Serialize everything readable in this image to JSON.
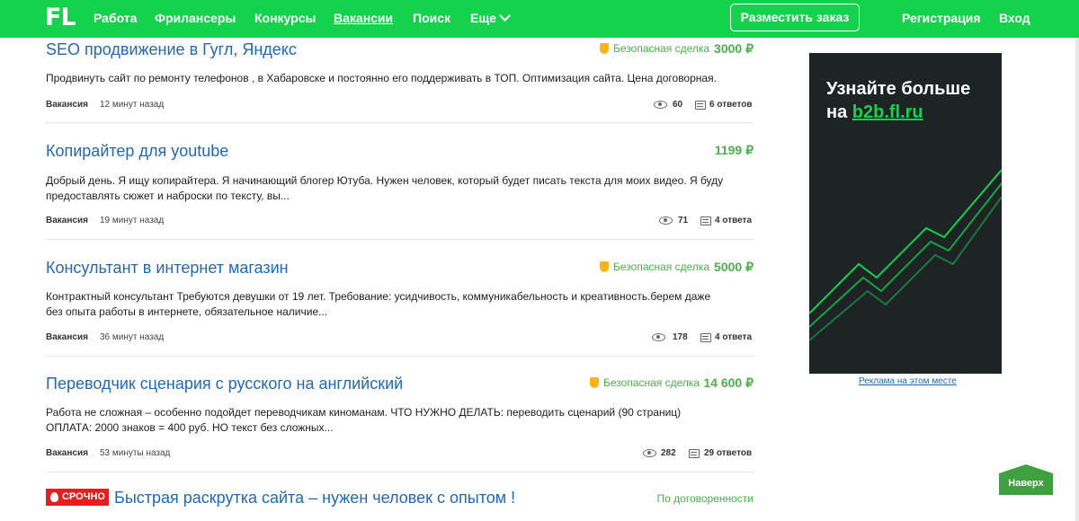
{
  "header": {
    "logo": "FL",
    "nav": [
      "Работа",
      "Фрилансеры",
      "Конкурсы",
      "Вакансии",
      "Поиск",
      "Еще"
    ],
    "post_order": "Разместить заказ",
    "register": "Регистрация",
    "login": "Вход"
  },
  "jobs": [
    {
      "title": "SEO продвижение в Гугл, Яндекс",
      "safe": "Безопасная сделка",
      "price": "3000 ₽",
      "desc": "Продвинуть сайт по ремонту телефонов  , в Хабаровске  и постоянно  его поддерживать в ТОП. Оптимизация  сайта. Цена договорная.",
      "type": "Вакансия",
      "time": "12 минут назад",
      "views": "60",
      "answers": "6 ответов"
    },
    {
      "title": "Копирайтер для youtube",
      "price": "1199 ₽",
      "desc": "Добрый день. Я ищу копирайтера.   Я начинающий блогер Ютуба. Нужен человек, который будет писать текста для моих видео. Я буду предоставлять сюжет и наброски по тексту, вы...",
      "type": "Вакансия",
      "time": "19 минут назад",
      "views": "71",
      "answers": "4 ответа"
    },
    {
      "title": "Консультант в интернет магазин",
      "safe": "Безопасная сделка",
      "price": "5000 ₽",
      "desc": "Контрактный консультант  Требуются девушки от 19 лет. Требование: усидчивость, коммуникабельность и креативность.берем даже без опыта работы в интернете, обязательное наличие...",
      "type": "Вакансия",
      "time": "36 минут назад",
      "views": "178",
      "answers": "4 ответа"
    },
    {
      "title": "Переводчик сценария с русского на английский",
      "safe": "Безопасная сделка",
      "price": "14 600 ₽",
      "desc": "Работа не сложная – особенно подойдет переводчикам киноманам.  ЧТО НУЖНО ДЕЛАТЬ: переводить сценарий (90 страниц)  ОПЛАТА: 2000 знаков = 400 руб.  НО текст без сложных...",
      "type": "Вакансия",
      "time": "53 минуты назад",
      "views": "282",
      "answers": "29 ответов"
    },
    {
      "badge": "СРОЧНО",
      "title": "Быстрая раскрутка сайта – нужен человек с опытом !",
      "price": "По договоренности"
    }
  ],
  "ad": {
    "line1": "Узнайте больше",
    "line2_prefix": "на",
    "line2_link": "b2b.fl.ru",
    "caption": "Реклама на этом месте"
  },
  "up_button": "Наверх",
  "colors": {
    "brand": "#14d24b",
    "link": "#1f68b6",
    "price": "#4ab04a",
    "urgent": "#e51e1e",
    "shield": "#f7b516",
    "ad_bg": "#1e2326"
  },
  "icons": [
    "eye-icon",
    "comment-icon",
    "shield-icon",
    "flame-icon",
    "chevron-down-icon"
  ]
}
